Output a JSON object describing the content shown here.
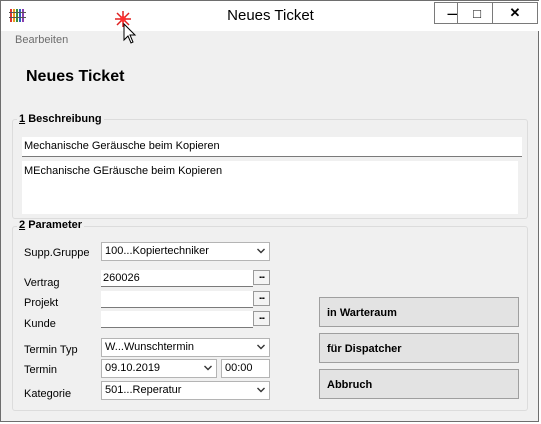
{
  "window": {
    "title": "Neues Ticket",
    "minimize_glyph": "—",
    "maximize_glyph": "□",
    "close_glyph": "✕"
  },
  "menu": {
    "edit": "Bearbeiten"
  },
  "page": {
    "heading": "Neues Ticket"
  },
  "beschreibung": {
    "group_number": "1",
    "group_label": "Beschreibung",
    "summary_value": "Mechanische Geräusche beim Kopieren",
    "detail_value": "MEchanische GEräusche beim Kopieren"
  },
  "parameter": {
    "group_number": "2",
    "group_label": "Parameter",
    "supp_gruppe": {
      "label": "Supp.Gruppe",
      "value": "100...Kopiertechniker"
    },
    "vertrag": {
      "label": "Vertrag",
      "value": "260026"
    },
    "projekt": {
      "label": "Projekt",
      "value": ""
    },
    "kunde": {
      "label": "Kunde",
      "value": ""
    },
    "termin_typ": {
      "label": "Termin Typ",
      "value": "W...Wunschtermin"
    },
    "termin": {
      "label": "Termin",
      "date": "09.10.2019",
      "time": "00:00"
    },
    "kategorie": {
      "label": "Kategorie",
      "value": "501...Reperatur"
    },
    "ellipsis": "..."
  },
  "actions": {
    "warteraum": "in Warteraum",
    "dispatcher": "für Dispatcher",
    "abbruch": "Abbruch"
  }
}
